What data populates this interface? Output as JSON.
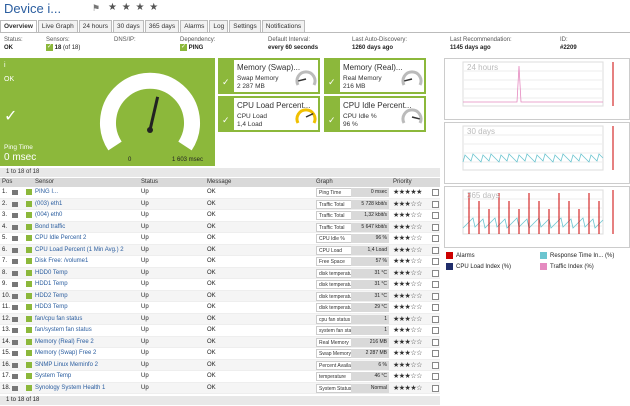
{
  "title": "Device i...",
  "stars": "★ ★ ★ ★",
  "tabs": [
    "Overview",
    "Live Graph",
    "24 hours",
    "30 days",
    "365 days",
    "Alarms",
    "Log",
    "Settings",
    "Notifications"
  ],
  "info": {
    "status_label": "Status:",
    "status_value": "OK",
    "sensors_label": "Sensors:",
    "sensors_value": "18",
    "sensors_of": "(of 18)",
    "dns_label": "DNS/IP:",
    "dependency_label": "Dependency:",
    "dependency_value": "PING",
    "interval_label": "Default Interval:",
    "interval_value": "every 60 seconds",
    "discovery_label": "Last Auto-Discovery:",
    "discovery_value": "1260 days ago",
    "recommend_label": "Last Recommendation:",
    "recommend_value": "1145 days ago",
    "id_label": "ID:",
    "id_value": "#2209"
  },
  "big_gauge": {
    "name": "i",
    "status": "OK",
    "sub": "Ping Time",
    "value": "0 msec",
    "min": "0",
    "max": "1 603 msec",
    "level": 0.55
  },
  "gauges": [
    {
      "name": "Memory (Swap)...",
      "sub": "Swap Memory",
      "value": "2 287 MB",
      "level": 0.1,
      "color": "#333"
    },
    {
      "name": "Memory (Real)...",
      "sub": "Real Memory",
      "value": "216 MB",
      "level": 0.1,
      "color": "#333"
    },
    {
      "name": "CPU Load Percent...",
      "sub": "CPU Load",
      "value": "1,4 Load",
      "level": 0.75,
      "color": "#f0c000"
    },
    {
      "name": "CPU Idle Percent...",
      "sub": "CPU Idle %",
      "value": "96 %",
      "level": 0.9,
      "color": "#333"
    }
  ],
  "charts": [
    {
      "title": "24 hours"
    },
    {
      "title": "30 days"
    },
    {
      "title": "365 days"
    }
  ],
  "legend": [
    {
      "label": "Alarms",
      "color": "#cc0000"
    },
    {
      "label": "Response Time In...",
      "color": "#6cc5d0",
      "unit": "(%)"
    },
    {
      "label": "CPU Load Index",
      "color": "#1f2d6b",
      "unit": "(%)"
    },
    {
      "label": "Traffic Index",
      "color": "#e58ac0",
      "unit": "(%)"
    }
  ],
  "pager": {
    "text": "1 to 18 of 18"
  },
  "table": {
    "headers": [
      "Pos",
      "Sensor",
      "Status",
      "Message",
      "Graph",
      "Priority"
    ],
    "rows": [
      {
        "pos": "1.",
        "sensor": "PING I...",
        "status": "Up",
        "msg": "OK",
        "graph": "Ping Time",
        "gval": "0 msec",
        "prio": "★★★★★"
      },
      {
        "pos": "2.",
        "sensor": "(003) eth1",
        "status": "Up",
        "msg": "OK",
        "graph": "Traffic Total",
        "gval": "5 728 kbit/s",
        "prio": "★★★☆☆"
      },
      {
        "pos": "3.",
        "sensor": "(004) eth0",
        "status": "Up",
        "msg": "OK",
        "graph": "Traffic Total",
        "gval": "1,32 kbit/s",
        "prio": "★★★☆☆"
      },
      {
        "pos": "4.",
        "sensor": "Bond traffic",
        "status": "Up",
        "msg": "OK",
        "graph": "Traffic Total",
        "gval": "5 647 kbit/s",
        "prio": "★★★☆☆"
      },
      {
        "pos": "5.",
        "sensor": "CPU Idle Percent 2",
        "status": "Up",
        "msg": "OK",
        "graph": "CPU Idle %",
        "gval": "96 %",
        "prio": "★★★☆☆"
      },
      {
        "pos": "6.",
        "sensor": "CPU Load Percent (1 Min Avg.) 2",
        "status": "Up",
        "msg": "OK",
        "graph": "CPU Load",
        "gval": "1,4 Load",
        "prio": "★★★☆☆"
      },
      {
        "pos": "7.",
        "sensor": "Disk Free: /volume1",
        "status": "Up",
        "msg": "OK",
        "graph": "Free Space",
        "gval": "57 %",
        "prio": "★★★☆☆"
      },
      {
        "pos": "8.",
        "sensor": "HDD0 Temp",
        "status": "Up",
        "msg": "OK",
        "graph": "disk temperature",
        "gval": "31 °C",
        "prio": "★★★☆☆"
      },
      {
        "pos": "9.",
        "sensor": "HDD1 Temp",
        "status": "Up",
        "msg": "OK",
        "graph": "disk temperature",
        "gval": "31 °C",
        "prio": "★★★☆☆"
      },
      {
        "pos": "10.",
        "sensor": "HDD2 Temp",
        "status": "Up",
        "msg": "OK",
        "graph": "disk temperature",
        "gval": "31 °C",
        "prio": "★★★☆☆"
      },
      {
        "pos": "11.",
        "sensor": "HDD3 Temp",
        "status": "Up",
        "msg": "OK",
        "graph": "disk temperature",
        "gval": "29 °C",
        "prio": "★★★☆☆"
      },
      {
        "pos": "12.",
        "sensor": "fan/cpu fan status",
        "status": "Up",
        "msg": "OK",
        "graph": "cpu fan status",
        "gval": "1",
        "prio": "★★★☆☆"
      },
      {
        "pos": "13.",
        "sensor": "fan/system fan status",
        "status": "Up",
        "msg": "OK",
        "graph": "system fan status",
        "gval": "1",
        "prio": "★★★☆☆"
      },
      {
        "pos": "14.",
        "sensor": "Memory (Real) Free 2",
        "status": "Up",
        "msg": "OK",
        "graph": "Real Memory",
        "gval": "216 MB",
        "prio": "★★★☆☆"
      },
      {
        "pos": "15.",
        "sensor": "Memory (Swap) Free 2",
        "status": "Up",
        "msg": "OK",
        "graph": "Swap Memory",
        "gval": "2 287 MB",
        "prio": "★★★☆☆"
      },
      {
        "pos": "16.",
        "sensor": "SNMP Linux Meminfo 2",
        "status": "Up",
        "msg": "OK",
        "graph": "Percent Available",
        "gval": "6 %",
        "prio": "★★★☆☆"
      },
      {
        "pos": "17.",
        "sensor": "System Temp",
        "status": "Up",
        "msg": "OK",
        "graph": "temperature",
        "gval": "46 °C",
        "prio": "★★★☆☆"
      },
      {
        "pos": "18.",
        "sensor": "Synology System Health 1",
        "status": "Up",
        "msg": "OK",
        "graph": "System Status",
        "gval": "Normal",
        "prio": "★★★★☆"
      }
    ]
  },
  "footer": {
    "text": "1 to 18 of 18"
  }
}
